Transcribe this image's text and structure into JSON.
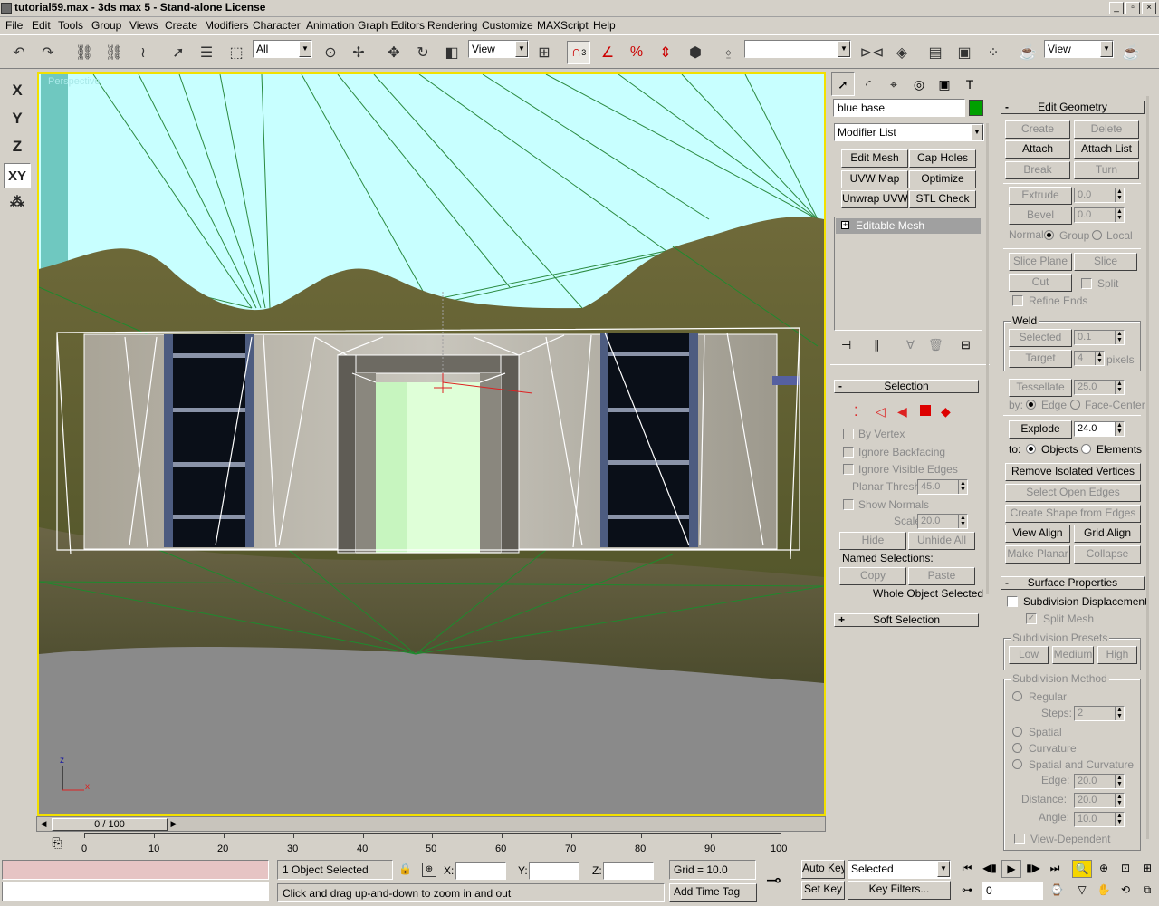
{
  "window": {
    "title": "tutorial59.max - 3ds max 5 - Stand-alone License",
    "buttons": [
      "_",
      "▫",
      "×"
    ]
  },
  "menu": [
    "File",
    "Edit",
    "Tools",
    "Group",
    "Views",
    "Create",
    "Modifiers",
    "Character",
    "Animation",
    "Graph Editors",
    "Rendering",
    "Customize",
    "MAXScript",
    "Help"
  ],
  "toolbar": {
    "selection_filter": "All",
    "ref_coord": "View",
    "named_selection": "",
    "render_type": "View",
    "snap_value": "3"
  },
  "axis_buttons": [
    "X",
    "Y",
    "Z",
    "XY"
  ],
  "viewport": {
    "label": "Perspective",
    "axis_z": "z",
    "axis_x": "x"
  },
  "time": {
    "slider_label": "0 / 100",
    "ticks": [
      "0",
      "10",
      "20",
      "30",
      "40",
      "50",
      "60",
      "70",
      "80",
      "90",
      "100"
    ]
  },
  "command_panel": {
    "object_name": "blue base",
    "object_color": "#00a000",
    "modifier_list": "Modifier List",
    "modifier_buttons": [
      "Edit Mesh",
      "Cap Holes",
      "UVW Map",
      "Optimize",
      "Unwrap UVW",
      "STL Check"
    ],
    "stack_item": "Editable Mesh",
    "selection": {
      "title": "Selection",
      "by_vertex": "By Vertex",
      "ignore_backfacing": "Ignore Backfacing",
      "ignore_visible_edges": "Ignore Visible Edges",
      "planar_thresh_label": "Planar Thresh:",
      "planar_thresh": "45.0",
      "show_normals": "Show Normals",
      "scale_label": "Scale:",
      "scale": "20.0",
      "hide": "Hide",
      "unhide_all": "Unhide All",
      "named_selections": "Named Selections:",
      "copy": "Copy",
      "paste": "Paste",
      "status": "Whole Object Selected"
    },
    "soft_selection": "Soft Selection"
  },
  "edit_geometry": {
    "title": "Edit Geometry",
    "create": "Create",
    "delete": "Delete",
    "attach": "Attach",
    "attach_list": "Attach List",
    "break": "Break",
    "turn": "Turn",
    "extrude": "Extrude",
    "extrude_val": "0.0",
    "bevel": "Bevel",
    "bevel_val": "0.0",
    "normal_label": "Normal:",
    "group": "Group",
    "local": "Local",
    "slice_plane": "Slice Plane",
    "slice": "Slice",
    "cut": "Cut",
    "split": "Split",
    "refine_ends": "Refine Ends",
    "weld": "Weld",
    "selected": "Selected",
    "selected_val": "0.1",
    "target": "Target",
    "target_val": "4",
    "pixels": "pixels",
    "tessellate": "Tessellate",
    "tessellate_val": "25.0",
    "by_label": "by:",
    "edge": "Edge",
    "face_center": "Face-Center",
    "explode": "Explode",
    "explode_val": "24.0",
    "to_label": "to:",
    "objects": "Objects",
    "elements": "Elements",
    "remove_isolated": "Remove Isolated Vertices",
    "select_open_edges": "Select Open Edges",
    "create_shape": "Create Shape from Edges",
    "view_align": "View Align",
    "grid_align": "Grid Align",
    "make_planar": "Make Planar",
    "collapse": "Collapse"
  },
  "surface": {
    "title": "Surface Properties",
    "subdiv_disp": "Subdivision Displacement",
    "split_mesh": "Split Mesh",
    "presets_label": "Subdivision Presets",
    "low": "Low",
    "medium": "Medium",
    "high": "High",
    "method_label": "Subdivision Method",
    "regular": "Regular",
    "steps_label": "Steps:",
    "steps": "2",
    "spatial": "Spatial",
    "curvature": "Curvature",
    "spatial_curv": "Spatial and Curvature",
    "edge_label": "Edge:",
    "edge_val": "20.0",
    "distance_label": "Distance:",
    "distance_val": "20.0",
    "angle_label": "Angle:",
    "angle_val": "10.0",
    "view_dependent": "View-Dependent"
  },
  "status": {
    "selected_count": "1 Object Selected",
    "prompt": "Click and drag up-and-down to zoom in and out",
    "x_label": "X:",
    "y_label": "Y:",
    "z_label": "Z:",
    "grid": "Grid = 10.0",
    "add_time_tag": "Add Time Tag",
    "auto_key": "Auto Key",
    "set_key": "Set Key",
    "key_mode": "Selected",
    "key_filters": "Key Filters...",
    "frame": "0"
  }
}
